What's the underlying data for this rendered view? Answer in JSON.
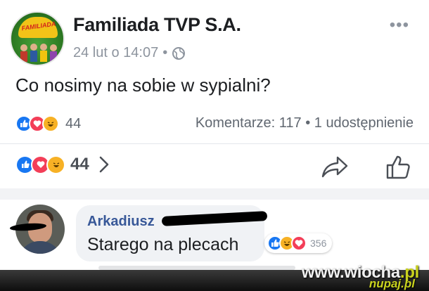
{
  "post": {
    "page_name": "Familiada TVP S.A.",
    "logo_text": "FAMILIADA",
    "date": "24 lut o 14:07",
    "meta_separator": "•",
    "more_icon": "more-horizontal-icon",
    "text": "Co nosimy na sobie w sypialni?"
  },
  "summary": {
    "reaction_icons": [
      "like-icon",
      "love-icon",
      "haha-icon"
    ],
    "reaction_count": "44",
    "comments_shares": "Komentarze: 117 • 1 udostępnienie"
  },
  "actions": {
    "reaction_count": "44",
    "chevron_icon": "chevron-right-icon",
    "share_icon": "share-arrow-icon",
    "like_icon": "thumbs-up-icon"
  },
  "comment": {
    "author": "Arkadiusz",
    "text": "Starego na plecach",
    "reaction_count": "356"
  },
  "watermark": {
    "site_main": "www.wiocha",
    "site_tld": ".pl",
    "site_sub": "nupaj.pl"
  },
  "colors": {
    "facebook_blue": "#1877f2",
    "love_red": "#f33e58",
    "haha_yellow": "#f7b125",
    "author_blue": "#385898",
    "meta_gray": "#8d949e"
  }
}
